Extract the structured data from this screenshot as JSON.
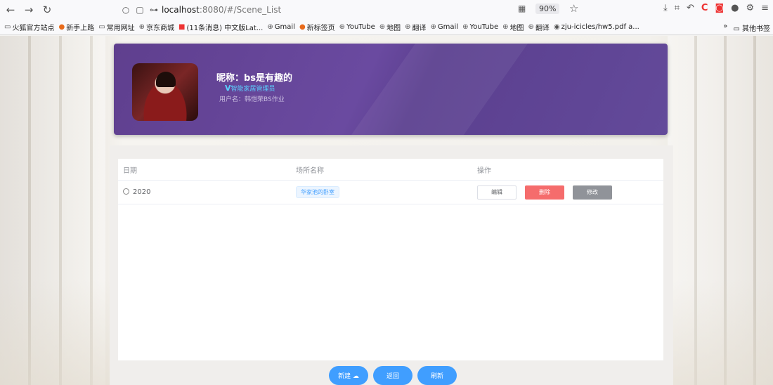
{
  "browser": {
    "url_host": "localhost",
    "url_path": ":8080/#/Scene_List",
    "zoom": "90%",
    "bookmarks": [
      "火狐官方站点",
      "新手上路",
      "常用网址",
      "京东商城",
      "(11条消息) 中文版Lat...",
      "Gmail",
      "新标签页",
      "YouTube",
      "地图",
      "翻译",
      "Gmail",
      "YouTube",
      "地图",
      "翻译",
      "zju-icicles/hw5.pdf a..."
    ],
    "bookmarks_more": "»",
    "other_bookmarks": "其他书签"
  },
  "profile": {
    "nickname": "昵称：bs是有趣的",
    "role_mark": "V",
    "role": "智能家居管理员",
    "username": "用户名：韩恺荣BS作业"
  },
  "table": {
    "headers": [
      "日期",
      "场所名称",
      "操作"
    ],
    "rows": [
      {
        "date": "2020",
        "place": "华家池的卧室"
      }
    ],
    "row_actions": {
      "edit": "编辑",
      "delete": "删除",
      "modify": "修改"
    }
  },
  "buttons": {
    "new": "新建 ☁",
    "back": "返回",
    "refresh": "刷新"
  }
}
